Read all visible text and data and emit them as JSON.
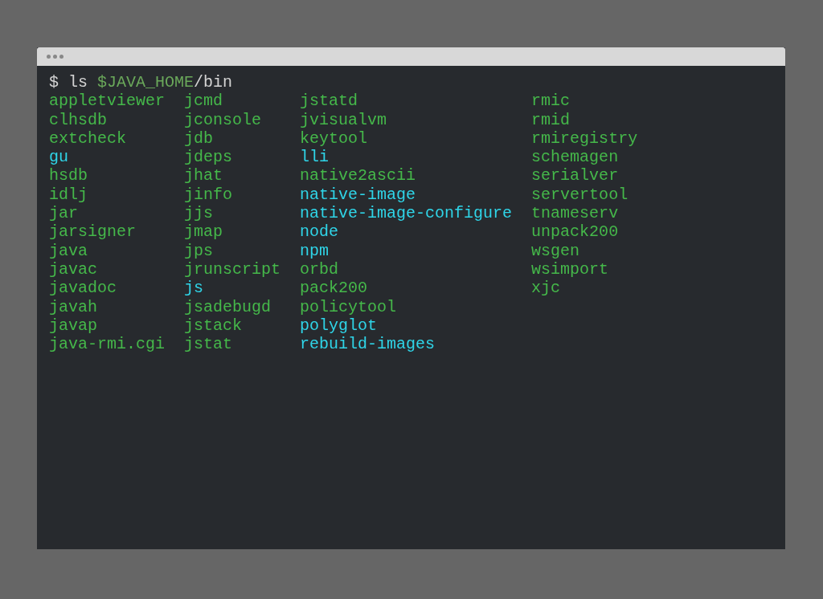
{
  "terminal": {
    "command_line": {
      "prompt": "$",
      "command": "ls",
      "variable": "$JAVA_HOME",
      "path": "/bin"
    },
    "columns": [
      {
        "entries": [
          {
            "name": "appletviewer",
            "color": "#45b84a"
          },
          {
            "name": "clhsdb",
            "color": "#45b84a"
          },
          {
            "name": "extcheck",
            "color": "#45b84a"
          },
          {
            "name": "gu",
            "color": "#2fd5e8"
          },
          {
            "name": "hsdb",
            "color": "#45b84a"
          },
          {
            "name": "idlj",
            "color": "#45b84a"
          },
          {
            "name": "jar",
            "color": "#45b84a"
          },
          {
            "name": "jarsigner",
            "color": "#45b84a"
          },
          {
            "name": "java",
            "color": "#45b84a"
          },
          {
            "name": "javac",
            "color": "#45b84a"
          },
          {
            "name": "javadoc",
            "color": "#45b84a"
          },
          {
            "name": "javah",
            "color": "#45b84a"
          },
          {
            "name": "javap",
            "color": "#45b84a"
          },
          {
            "name": "java-rmi.cgi",
            "color": "#45b84a"
          }
        ]
      },
      {
        "entries": [
          {
            "name": "jcmd",
            "color": "#45b84a"
          },
          {
            "name": "jconsole",
            "color": "#45b84a"
          },
          {
            "name": "jdb",
            "color": "#45b84a"
          },
          {
            "name": "jdeps",
            "color": "#45b84a"
          },
          {
            "name": "jhat",
            "color": "#45b84a"
          },
          {
            "name": "jinfo",
            "color": "#45b84a"
          },
          {
            "name": "jjs",
            "color": "#45b84a"
          },
          {
            "name": "jmap",
            "color": "#45b84a"
          },
          {
            "name": "jps",
            "color": "#45b84a"
          },
          {
            "name": "jrunscript",
            "color": "#45b84a"
          },
          {
            "name": "js",
            "color": "#2fd5e8"
          },
          {
            "name": "jsadebugd",
            "color": "#45b84a"
          },
          {
            "name": "jstack",
            "color": "#45b84a"
          },
          {
            "name": "jstat",
            "color": "#45b84a"
          }
        ]
      },
      {
        "entries": [
          {
            "name": "jstatd",
            "color": "#45b84a"
          },
          {
            "name": "jvisualvm",
            "color": "#45b84a"
          },
          {
            "name": "keytool",
            "color": "#45b84a"
          },
          {
            "name": "lli",
            "color": "#2fd5e8"
          },
          {
            "name": "native2ascii",
            "color": "#45b84a"
          },
          {
            "name": "native-image",
            "color": "#2fd5e8"
          },
          {
            "name": "native-image-configure",
            "color": "#2fd5e8"
          },
          {
            "name": "node",
            "color": "#2fd5e8"
          },
          {
            "name": "npm",
            "color": "#2fd5e8"
          },
          {
            "name": "orbd",
            "color": "#45b84a"
          },
          {
            "name": "pack200",
            "color": "#45b84a"
          },
          {
            "name": "policytool",
            "color": "#45b84a"
          },
          {
            "name": "polyglot",
            "color": "#2fd5e8"
          },
          {
            "name": "rebuild-images",
            "color": "#2fd5e8"
          }
        ]
      },
      {
        "entries": [
          {
            "name": "rmic",
            "color": "#45b84a"
          },
          {
            "name": "rmid",
            "color": "#45b84a"
          },
          {
            "name": "rmiregistry",
            "color": "#45b84a"
          },
          {
            "name": "schemagen",
            "color": "#45b84a"
          },
          {
            "name": "serialver",
            "color": "#45b84a"
          },
          {
            "name": "servertool",
            "color": "#45b84a"
          },
          {
            "name": "tnameserv",
            "color": "#45b84a"
          },
          {
            "name": "unpack200",
            "color": "#45b84a"
          },
          {
            "name": "wsgen",
            "color": "#45b84a"
          },
          {
            "name": "wsimport",
            "color": "#45b84a"
          },
          {
            "name": "xjc",
            "color": "#45b84a"
          }
        ]
      }
    ]
  }
}
